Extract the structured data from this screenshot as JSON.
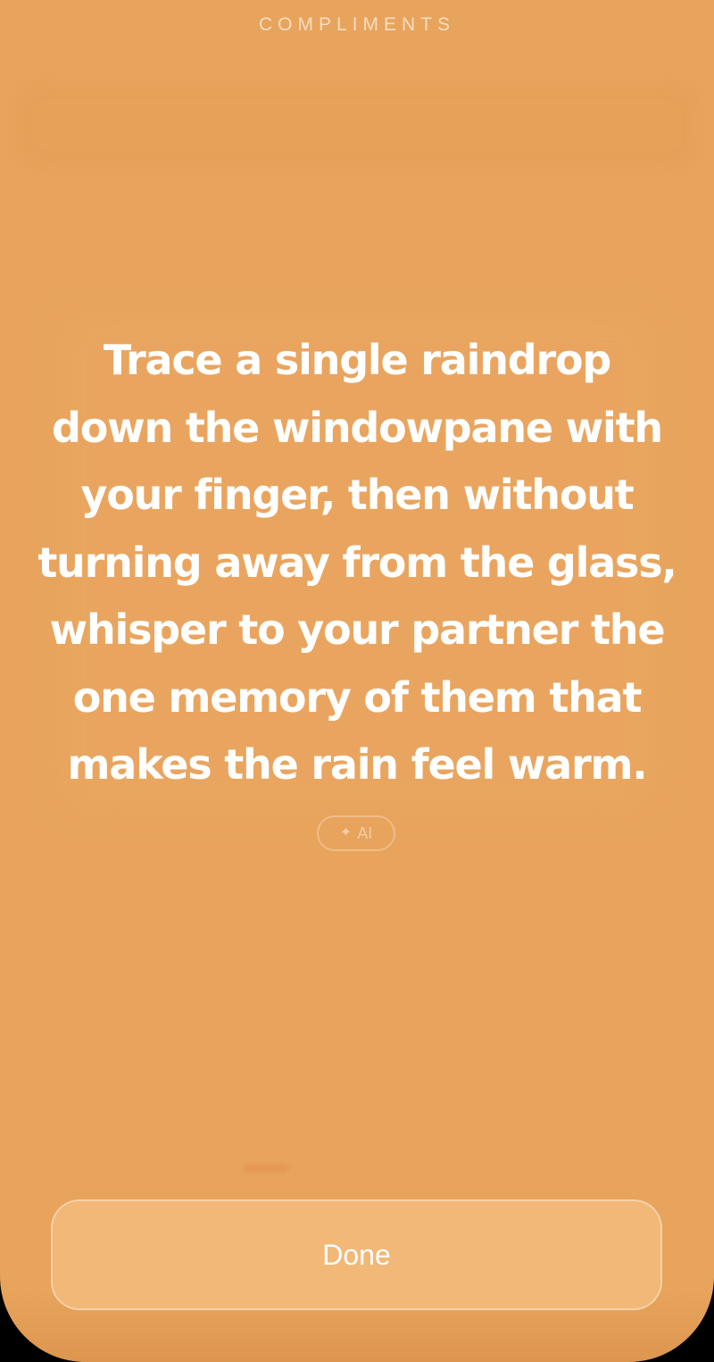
{
  "header": {
    "category": "COMPLIMENTS"
  },
  "card": {
    "prompt": "Trace a single raindrop\ndown the windowpane with\nyour finger, then without\nturning away from the glass,\nwhisper to your partner the\none memory of them that\nmakes the rain feel warm.",
    "badge_label": "AI",
    "badge_icon": "sparkle-icon"
  },
  "footer": {
    "done_label": "Done"
  },
  "colors": {
    "background": "#e8a45c",
    "button": "#f2b878",
    "text": "#ffffff"
  }
}
